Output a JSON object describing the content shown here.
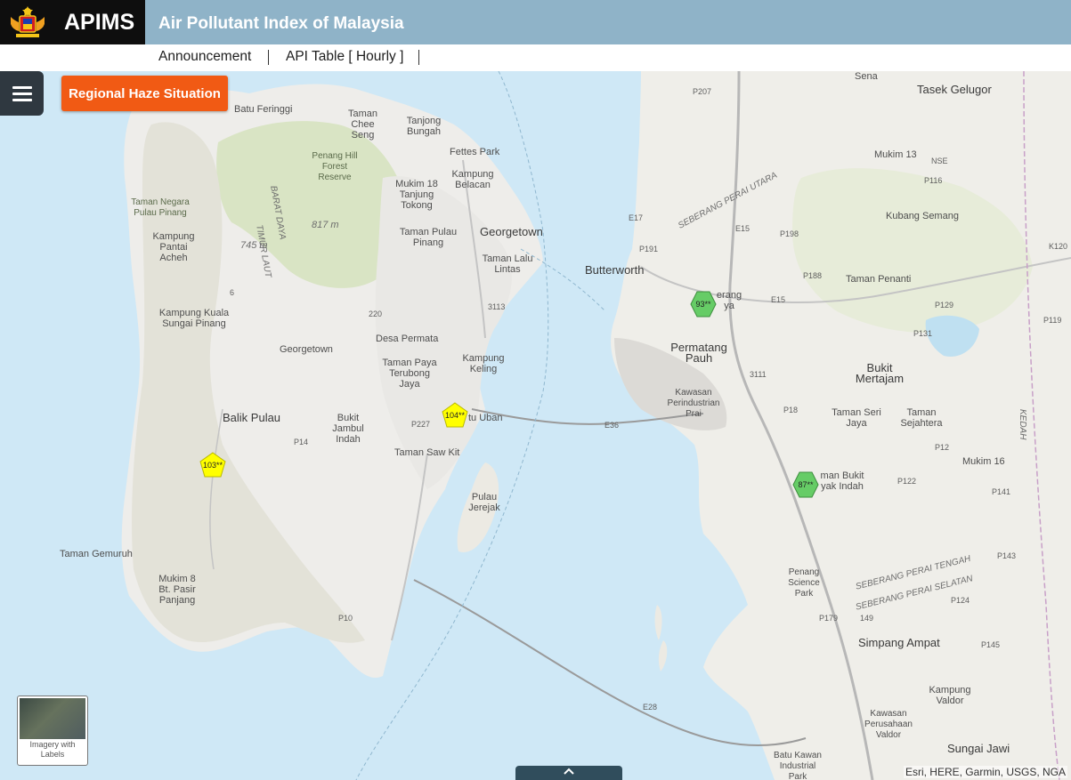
{
  "header": {
    "brand": "APIMS",
    "title": "Air Pollutant Index of Malaysia",
    "nav": [
      "Announcement",
      "API Table [ Hourly ]"
    ]
  },
  "controls": {
    "haze_button": "Regional Haze Situation",
    "basemap_label": "Imagery with Labels",
    "attribution": "Esri, HERE, Garmin, USGS, NGA"
  },
  "stations": [
    {
      "value": "103**",
      "level": "unhealthy",
      "color": "#ffff00",
      "shape": "pentagon"
    },
    {
      "value": "104**",
      "level": "unhealthy",
      "color": "#ffff00",
      "shape": "pentagon"
    },
    {
      "value": "93**",
      "level": "moderate",
      "color": "#66cc66",
      "shape": "hexagon"
    },
    {
      "value": "87**",
      "level": "moderate",
      "color": "#66cc66",
      "shape": "hexagon"
    }
  ],
  "map_labels": {
    "places": [
      "Batu Feringgi",
      "Taman Chee Seng",
      "Tanjong Bungah",
      "Fettes Park",
      "Penang Hill Forest Reserve",
      "Kampung Belacan",
      "Mukim 18 Tanjung Tokong",
      "Taman Negara Pulau Pinang",
      "Kampung Pantai Acheh",
      "Georgetown",
      "Taman Pulau Pinang",
      "Taman Lalu Lintas",
      "Butterworth",
      "Kampung Kuala Sungai Pinang",
      "Georgetown",
      "Desa Permata",
      "Taman Paya Terubong Jaya",
      "Kampung Keling",
      "Permatang Pauh",
      "Kawasan Perindustrian Prai",
      "Balik Pulau",
      "Bukit Jambul Indah",
      "tu Uban",
      "Taman Saw Kit",
      "Pulau Jerejak",
      "Taman Gemuruh",
      "Mukim 8 Bt. Pasir Panjang",
      "Sena",
      "Tasek Gelugor",
      "Mukim 13",
      "Kubang Semang",
      "Taman Penanti",
      "Bukit Mertajam",
      "Taman Seri Jaya",
      "Taman Sejahtera",
      "Mukim 16",
      "man Bukit yak Indah",
      "Penang Science Park",
      "Simpang Ampat",
      "Kampung Valdor",
      "Kawasan Perusahaan Valdor",
      "Sungai Jawi",
      "Batu Kawan Industrial Park",
      "erang ya"
    ],
    "hills": [
      "817 m",
      "745 m",
      "TIMUR LAUT",
      "BARAT DAYA"
    ],
    "districts": [
      "SEBERANG PERAI UTARA",
      "SEBERANG PERAI TENGAH",
      "SEBERANG PERAI SELATAN",
      "KEDAH"
    ],
    "roads": [
      "E36",
      "E28",
      "E15",
      "E17",
      "P191",
      "P188",
      "P129",
      "P131",
      "P12",
      "P14",
      "P10",
      "P18",
      "P141",
      "P143",
      "P145",
      "P124",
      "P179",
      "149",
      "3113",
      "3111",
      "6",
      "220",
      "P227",
      "P207",
      "P198",
      "P116",
      "P119",
      "K120",
      "E15",
      "NSE",
      "P122",
      "P130"
    ]
  }
}
